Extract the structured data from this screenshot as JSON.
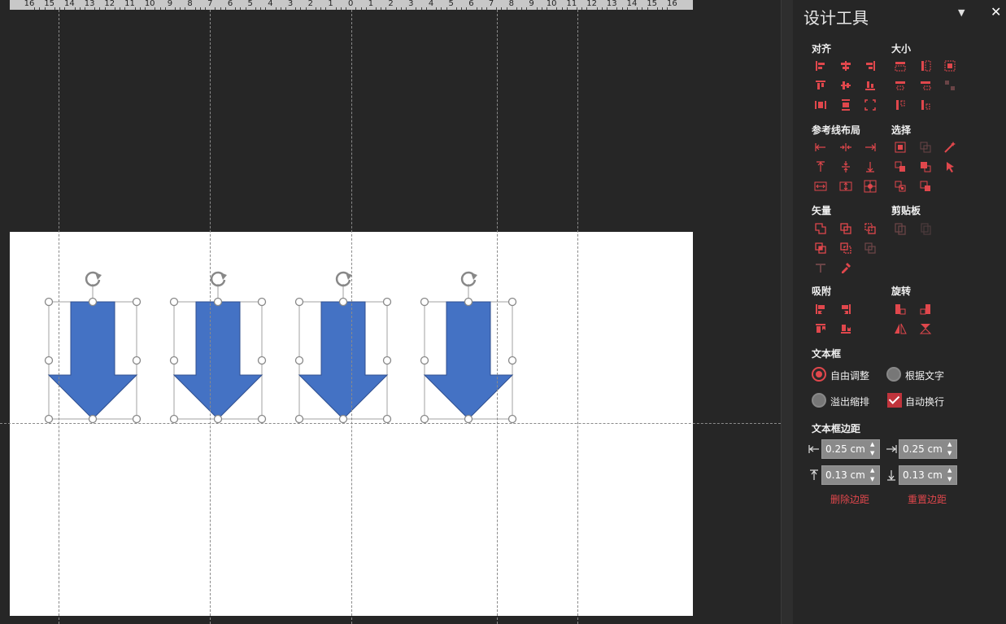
{
  "ruler": {
    "labels": [
      "16",
      "15",
      "14",
      "13",
      "12",
      "11",
      "10",
      "9",
      "8",
      "7",
      "6",
      "5",
      "4",
      "3",
      "2",
      "1",
      "0",
      "1",
      "2",
      "3",
      "4",
      "5",
      "6",
      "7",
      "8",
      "9",
      "10",
      "11",
      "12",
      "13",
      "14",
      "15",
      "16"
    ]
  },
  "panel": {
    "title": "设计工具",
    "sections": {
      "align": "对齐",
      "size": "大小",
      "guide_layout": "参考线布局",
      "select": "选择",
      "vector": "矢量",
      "clipboard": "剪贴板",
      "snap": "吸附",
      "rotate": "旋转",
      "textbox": "文本框",
      "textbox_margin": "文本框边距"
    },
    "textbox_options": {
      "free_adjust": "自由调整",
      "fit_text": "根据文字",
      "overflow_shrink": "溢出缩排",
      "auto_wrap": "自动换行"
    },
    "margins": {
      "left": "0.25 cm",
      "right": "0.25 cm",
      "top": "0.13 cm",
      "bottom": "0.13 cm"
    },
    "delete_margin": "删除边距",
    "reset_margin": "重置边距"
  },
  "icons": {
    "accent": "#e0474c",
    "disabled": "#6a4446"
  },
  "shape_color": "#4472c4"
}
